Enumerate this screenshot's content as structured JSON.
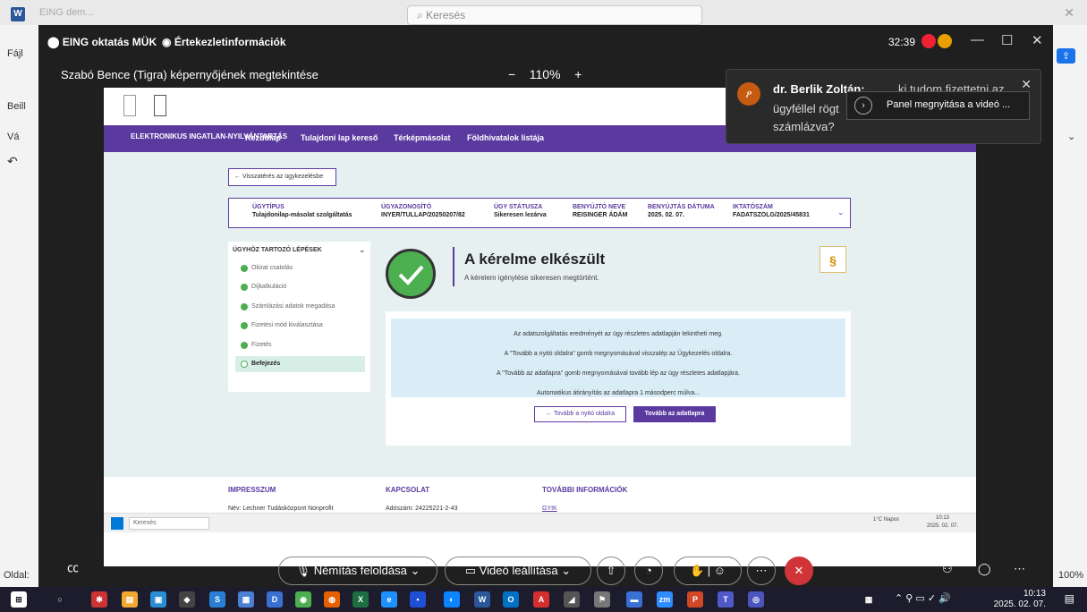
{
  "word": {
    "title": "EING dem...",
    "search_placeholder": "Keresés",
    "ribbon_file": "Fájl",
    "ribbon_paste": "Beill",
    "clipboard": "Vá",
    "status_page": "Oldal:",
    "zoom_percent": "100%"
  },
  "teams": {
    "meeting_title": "EING oktatás MÜK",
    "meeting_info": "Értekezletinformációk",
    "timer": "32:39",
    "share_title": "Szabó Bence (Tigra) képernyőjének megtekintése",
    "zoom_minus": "−",
    "zoom_level": "110%",
    "zoom_plus": "+"
  },
  "site": {
    "nav_logo": "ELEKTRONIKUS INGATLAN-NYILVÁNTARTÁS",
    "nav": [
      "Kezdőlap",
      "Tulajdoni lap kereső",
      "Térképmásolat",
      "Földhivatalok listája"
    ],
    "back_label": "Visszatérés az ügykezelésbe",
    "info_cols": [
      {
        "h": "ÜGYTÍPUS",
        "v": "Tulajdonilap-másolat szolgáltatás"
      },
      {
        "h": "ÜGYAZONOSÍTÓ",
        "v": "INYER/TULLAP/20250207/82"
      },
      {
        "h": "ÜGY STÁTUSZA",
        "v": "Sikeresen lezárva"
      },
      {
        "h": "BENYÚJTÓ NEVE",
        "v": "REISINGER ÁDÁM"
      },
      {
        "h": "BENYÚJTÁS DÁTUMA",
        "v": "2025. 02. 07."
      },
      {
        "h": "IKTATÓSZÁM",
        "v": "FADATSZOLG/2025/45831"
      }
    ],
    "steps_title": "ÜGYHÖZ TARTOZÓ LÉPÉSEK",
    "steps": [
      "Okirat csatolás",
      "Díjkalkuláció",
      "Számlázási adatok megadása",
      "Fizetési mód kiválasztása",
      "Fizetés",
      "Befejezés"
    ],
    "done_title": "A kérelme elkészült",
    "done_sub": "A kérelem igénylése sikeresen megtörtént.",
    "msg_lines": [
      "Az adatszolgáltatás eredményét az ügy részletes adatlapján tekintheti meg.",
      "A \"Tovább a nyitó oldalra\" gomb megnyomásával visszalép az Ügykezelés oldalra.",
      "A \"Tovább az adatlapra\" gomb megnyomásával tovább lép az ügy részletes adatlapjára.",
      "Automatikus átirányítás az adatlapra 1 másodperc múlva..."
    ],
    "btn_home": "Tovább a nyitó oldalra",
    "btn_sheet": "Tovább az adatlapra",
    "footer": {
      "impresszum": "IMPRESSZUM",
      "kapcsolat": "KAPCSOLAT",
      "tovabbi": "TOVÁBBI INFORMÁCIÓK",
      "nev": "Név: Lechner Tudásközpont Nonprofit",
      "adoszam": "Adószám: 24225221-2-43",
      "gyik": "GYIK"
    },
    "inner_search": "Keresés",
    "inner_weather": "1°C Napos",
    "inner_time": "10:13",
    "inner_date": "2025. 02. 07."
  },
  "notification": {
    "sender": "dr. Berlik Zoltán:",
    "text_line1": "ki tudom fizettetni az",
    "text_line2": "ügyféllel rögt",
    "text_line3": "számlázva?",
    "button": "Panel megnyitása a videó ..."
  },
  "controls": {
    "mute": "Némítás feloldása",
    "video": "Videó leállítása"
  },
  "taskbar": {
    "time": "10:13",
    "date": "2025. 02. 07."
  }
}
